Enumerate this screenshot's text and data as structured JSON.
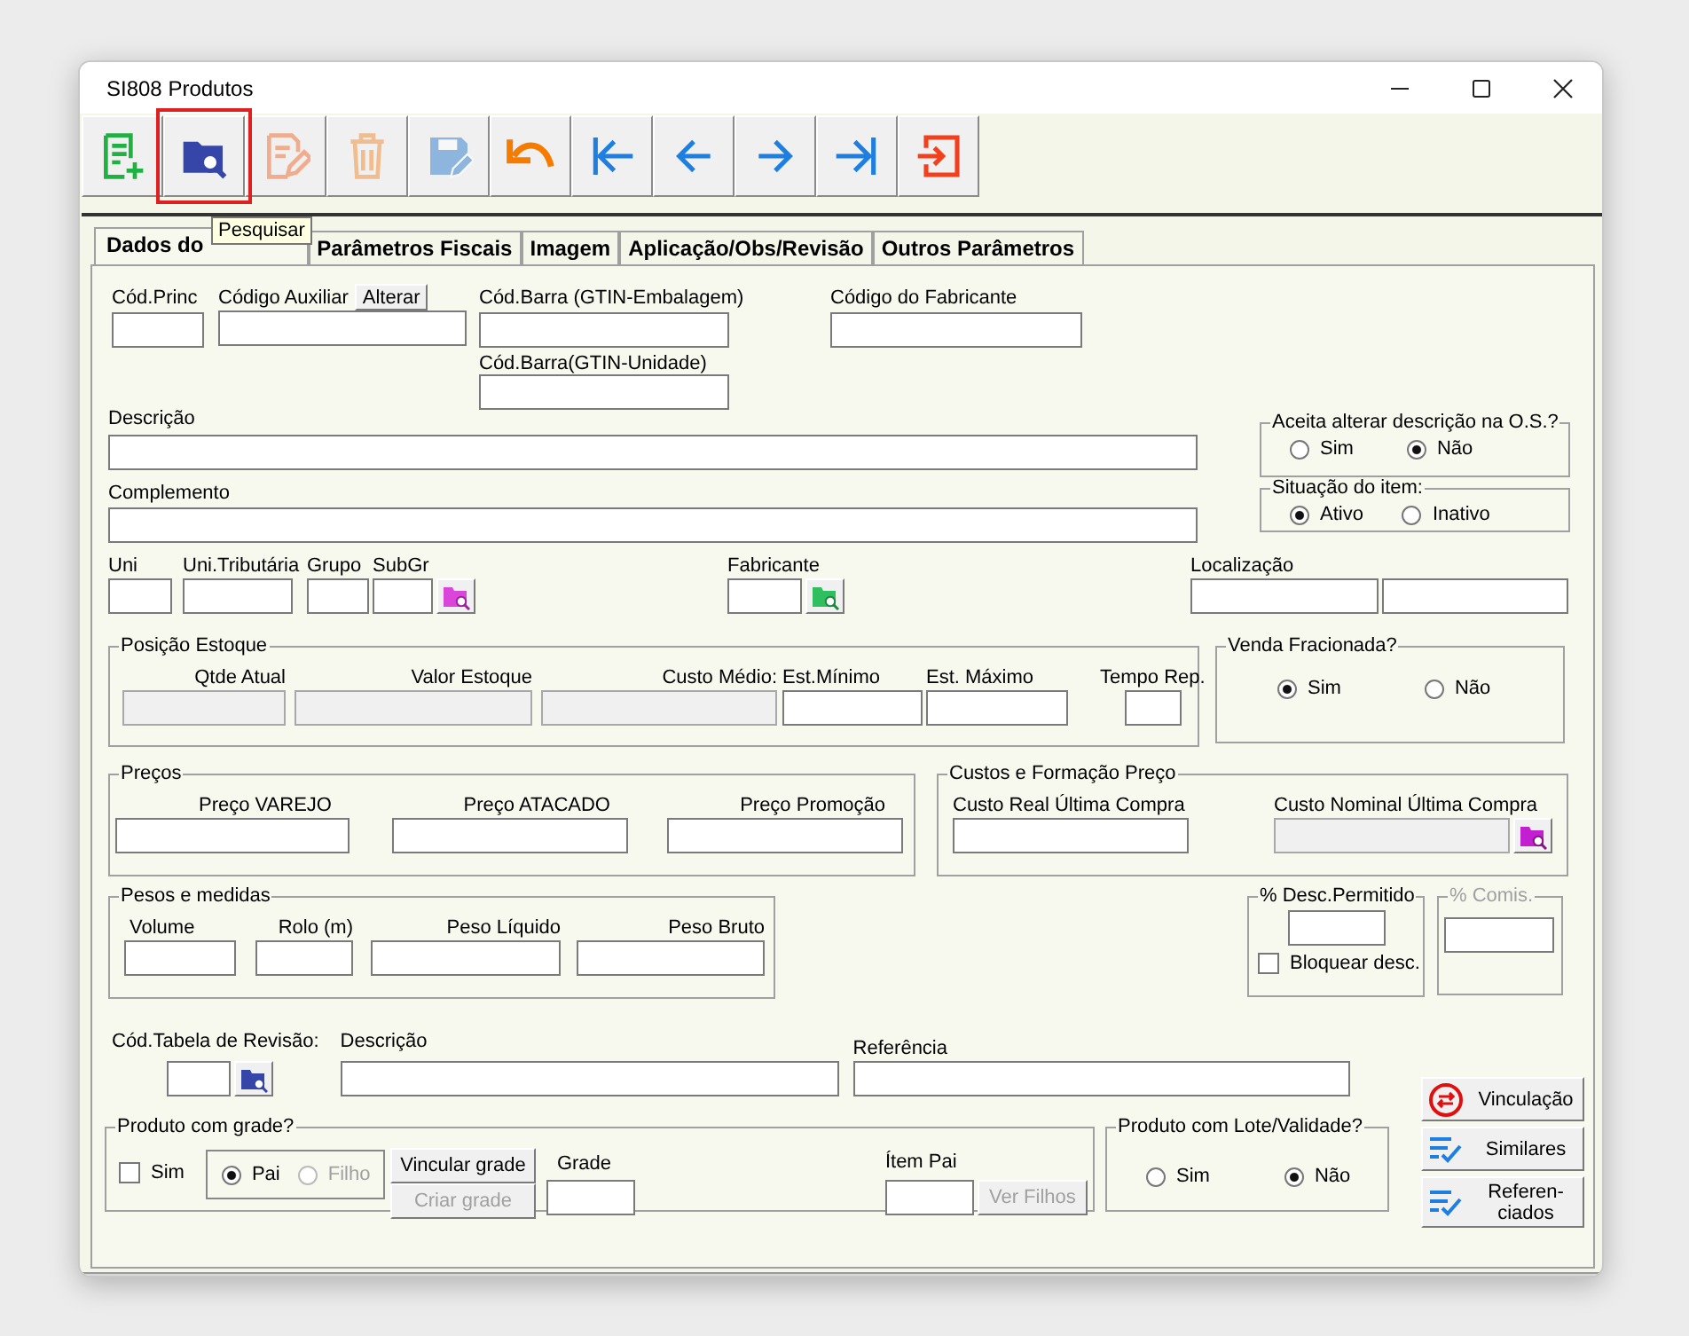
{
  "window": {
    "title": "SI808 Produtos"
  },
  "toolbar": [
    {
      "kind": "new",
      "selected": false,
      "disabled": false
    },
    {
      "kind": "search",
      "selected": true,
      "disabled": false
    },
    {
      "kind": "edit",
      "selected": false,
      "disabled": true
    },
    {
      "kind": "delete",
      "selected": false,
      "disabled": true
    },
    {
      "kind": "save",
      "selected": false,
      "disabled": true
    },
    {
      "kind": "undo",
      "selected": false,
      "disabled": false
    },
    {
      "kind": "first",
      "selected": false,
      "disabled": false
    },
    {
      "kind": "prev",
      "selected": false,
      "disabled": false
    },
    {
      "kind": "next",
      "selected": false,
      "disabled": false
    },
    {
      "kind": "last",
      "selected": false,
      "disabled": false
    },
    {
      "kind": "exit",
      "selected": false,
      "disabled": false
    }
  ],
  "tooltip": "Pesquisar",
  "tabs": [
    {
      "label": "Dados do",
      "selected": true
    },
    {
      "label": "Parâmetros Fiscais",
      "selected": false
    },
    {
      "label": "Imagem",
      "selected": false
    },
    {
      "label": "Aplicação/Obs/Revisão",
      "selected": false
    },
    {
      "label": "Outros Parâmetros",
      "selected": false
    }
  ],
  "identification": {
    "cod_princ": "Cód.Princ",
    "codigo_auxiliar": "Código Auxiliar",
    "alterar_button": "Alterar",
    "cod_barra_embalagem": "Cód.Barra (GTIN-Embalagem)",
    "cod_barra_unidade": "Cód.Barra(GTIN-Unidade)",
    "codigo_fabricante": "Código do Fabricante"
  },
  "descricao": "Descrição",
  "complemento": "Complemento",
  "aceita_alterar": {
    "title": "Aceita alterar descrição na O.S.?",
    "options": [
      {
        "label": "Sim",
        "selected": false
      },
      {
        "label": "Não",
        "selected": true
      }
    ]
  },
  "situacao": {
    "title": "Situação do item:",
    "options": [
      {
        "label": "Ativo",
        "selected": true
      },
      {
        "label": "Inativo",
        "selected": false
      }
    ]
  },
  "units": {
    "uni": "Uni",
    "uni_tributaria": "Uni.Tributária",
    "grupo": "Grupo",
    "subgr": "SubGr",
    "fabricante": "Fabricante",
    "localizacao": "Localização"
  },
  "posicao_estoque": {
    "title": "Posição Estoque",
    "fields": [
      {
        "label": "Qtde Atual",
        "disabled": true
      },
      {
        "label": "Valor Estoque",
        "disabled": true
      },
      {
        "label": "Custo Médio:",
        "disabled": true
      },
      {
        "label": "Est.Mínimo",
        "disabled": false
      },
      {
        "label": "Est. Máximo",
        "disabled": false
      },
      {
        "label": "Tempo Rep.",
        "disabled": false
      }
    ]
  },
  "venda_fracionada": {
    "title": "Venda Fracionada?",
    "options": [
      {
        "label": "Sim",
        "selected": true
      },
      {
        "label": "Não",
        "selected": false
      }
    ]
  },
  "precos": {
    "title": "Preços",
    "fields": [
      {
        "label": "Preço VAREJO"
      },
      {
        "label": "Preço ATACADO"
      },
      {
        "label": "Preço Promoção"
      }
    ]
  },
  "custos": {
    "title": "Custos e Formação Preço",
    "fields": [
      {
        "label": "Custo Real Última Compra",
        "disabled": false
      },
      {
        "label": "Custo Nominal Última Compra",
        "disabled": true
      }
    ]
  },
  "pesos": {
    "title": "Pesos e medidas",
    "fields": [
      {
        "label": "Volume"
      },
      {
        "label": "Rolo (m)"
      },
      {
        "label": "Peso Líquido"
      },
      {
        "label": "Peso Bruto"
      }
    ]
  },
  "desc_permitido": {
    "title": "% Desc.Permitido",
    "checkbox": {
      "label": "Bloquear desc.",
      "checked": false
    }
  },
  "comis": {
    "title": "% Comis.",
    "disabled": true
  },
  "revisao": {
    "cod_tabela": "Cód.Tabela de Revisão:",
    "descricao": "Descrição",
    "referencia": "Referência"
  },
  "grade": {
    "title": "Produto com grade?",
    "sim": {
      "label": "Sim",
      "checked": false
    },
    "options": [
      {
        "label": "Pai",
        "selected": true,
        "disabled": false
      },
      {
        "label": "Filho",
        "selected": false,
        "disabled": true
      }
    ],
    "vincular_button": {
      "label": "Vincular grade",
      "disabled": false
    },
    "criar_button": {
      "label": "Criar grade",
      "disabled": true
    },
    "grade_label": "Grade",
    "item_pai": "Ítem Pai",
    "ver_filhos": {
      "label": "Ver Filhos",
      "disabled": true
    }
  },
  "lote": {
    "title": "Produto com Lote/Validade?",
    "options": [
      {
        "label": "Sim",
        "selected": false
      },
      {
        "label": "Não",
        "selected": true
      }
    ]
  },
  "side_buttons": [
    {
      "kind": "link",
      "label": "Vinculação"
    },
    {
      "kind": "list",
      "label": "Similares"
    },
    {
      "kind": "list",
      "label": "Referen-\nciados"
    }
  ]
}
